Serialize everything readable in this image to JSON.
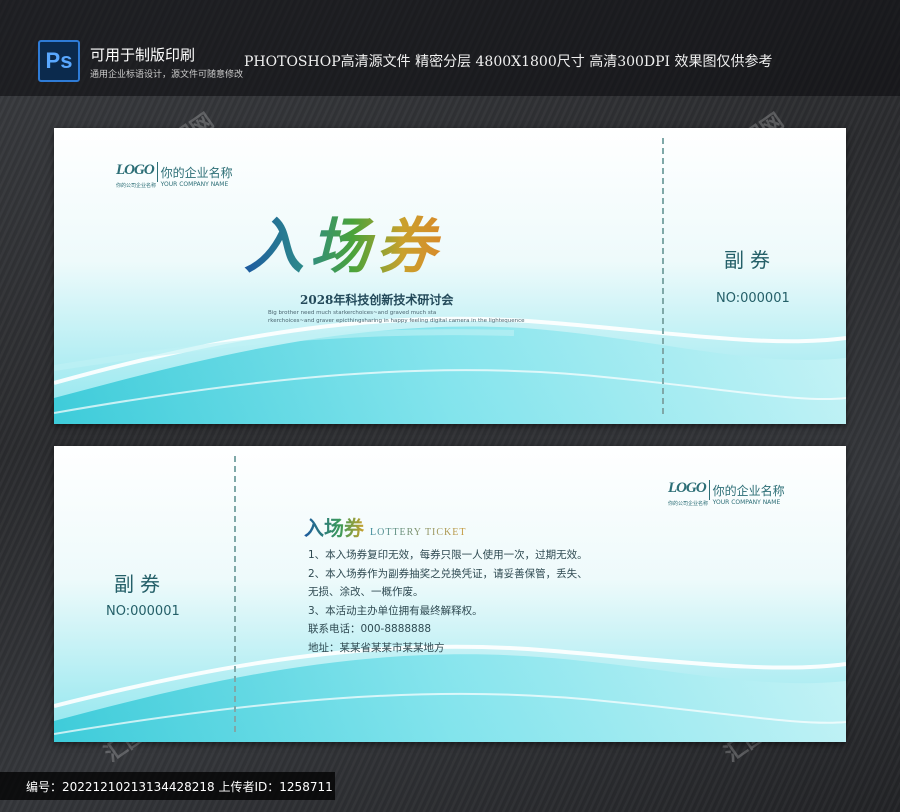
{
  "banner": {
    "ps_icon": "Ps",
    "title": "可用于制版印刷",
    "subtitle": "通用企业标语设计，源文件可随意修改",
    "info": "PHOTOSHOP高清源文件  精密分层  4800X1800尺寸  高清300DPI  效果图仅供参考"
  },
  "ticket1": {
    "logo_mark": "LOGO",
    "logo_name": "你的企业名称",
    "logo_en": "YOUR COMPANY NAME",
    "logo_cn_small": "你的公司企业名称",
    "title": "入场券",
    "subtitle": "2028年科技创新技术研讨会",
    "en_line1": "Big brother need much starkerchoices~and graved much sta",
    "en_line2": "rkerchoices~and graver epicthingsharing in happy feeling digital camera in the lightequence",
    "stub_title": "副券",
    "stub_no": "NO:000001"
  },
  "ticket2": {
    "stub_title": "副券",
    "stub_no": "NO:000001",
    "logo_mark": "LOGO",
    "logo_name": "你的企业名称",
    "logo_en": "YOUR COMPANY NAME",
    "logo_cn_small": "你的公司企业名称",
    "title_cn": "入场券",
    "title_en": "LOTTERY TICKET",
    "rules": [
      "1、本入场券复印无效，每券只限一人使用一次，过期无效。",
      "2、本入场券作为副券抽奖之兑换凭证，请妥善保管，丢失、",
      "无损、涂改、一概作废。",
      "3、本活动主办单位拥有最终解释权。",
      "联系电话：000-8888888",
      "地址：某某省某某市某某地方"
    ]
  },
  "footer": {
    "text": "编号：20221210213134428218 上传者ID：1258711"
  },
  "watermark": "汇图网",
  "colors": {
    "accent_teal": "#245f68",
    "wave_cyan": "#3fcfdc"
  }
}
